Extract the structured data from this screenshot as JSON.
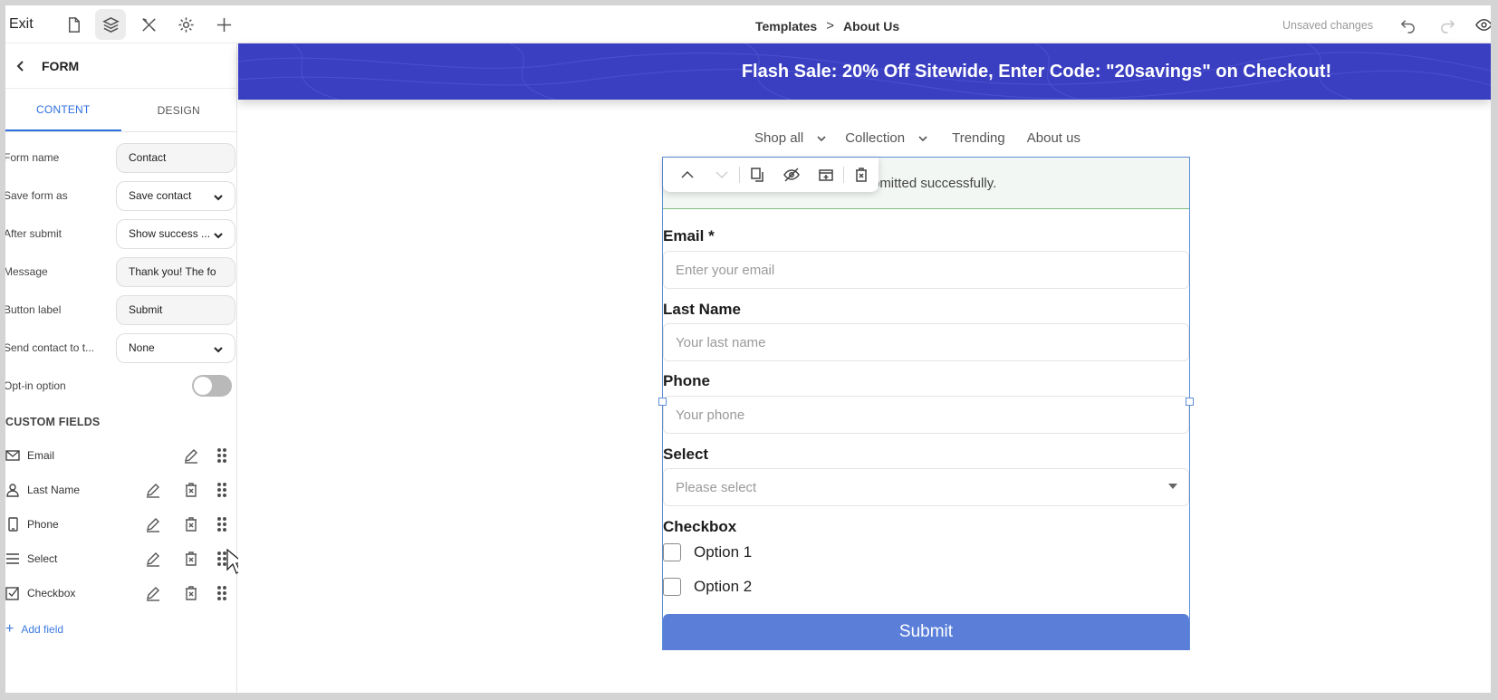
{
  "topbar": {
    "exit_label": "Exit",
    "icons": [
      "page-icon",
      "layers-icon",
      "tools-icon",
      "settings-icon",
      "plus-icon"
    ],
    "breadcrumb": [
      "Templates",
      "About Us"
    ],
    "breadcrumb_separator": ">",
    "status": "Unsaved changes"
  },
  "sidebar": {
    "title": "FORM",
    "tabs": [
      "CONTENT",
      "DESIGN"
    ],
    "active_tab": "CONTENT",
    "properties": [
      {
        "label": "Form name",
        "value": "Contact",
        "type": "text"
      },
      {
        "label": "Save form as",
        "value": "Save contact",
        "type": "select"
      },
      {
        "label": "After submit",
        "value": "Show success ...",
        "type": "select"
      },
      {
        "label": "Message",
        "value": "Thank you! The fo",
        "type": "text"
      },
      {
        "label": "Button label",
        "value": "Submit",
        "type": "text"
      },
      {
        "label": "Send contact to t...",
        "value": "None",
        "type": "select"
      }
    ],
    "optin": {
      "label": "Opt-in option",
      "enabled": false
    },
    "custom_fields_title": "CUSTOM FIELDS",
    "custom_fields": [
      {
        "label": "Email",
        "icon": "mail-icon",
        "deletable": false
      },
      {
        "label": "Last Name",
        "icon": "person-icon",
        "deletable": true
      },
      {
        "label": "Phone",
        "icon": "phone-icon",
        "deletable": true
      },
      {
        "label": "Select",
        "icon": "list-icon",
        "deletable": true
      },
      {
        "label": "Checkbox",
        "icon": "checkbox-icon",
        "deletable": true
      }
    ],
    "add_field_label": "Add field"
  },
  "canvas": {
    "banner_text": "Flash Sale: 20% Off Sitewide, Enter Code: \"20savings\" on Checkout!",
    "banner_color": "#3a3fc2",
    "nav": [
      {
        "label": "Shop all",
        "dropdown": true
      },
      {
        "label": "Collection",
        "dropdown": true
      },
      {
        "label": "Trending",
        "dropdown": false
      },
      {
        "label": "About us",
        "dropdown": false
      }
    ],
    "form": {
      "success_message": "Thank you! The form was submitted successfully.",
      "fields": [
        {
          "label": "Email *",
          "placeholder": "Enter your email",
          "type": "input"
        },
        {
          "label": "Last Name",
          "placeholder": "Your last name",
          "type": "input"
        },
        {
          "label": "Phone",
          "placeholder": "Your phone",
          "type": "input"
        },
        {
          "label": "Select",
          "placeholder": "Please select",
          "type": "select"
        }
      ],
      "checkbox_label": "Checkbox",
      "checkbox_options": [
        "Option 1",
        "Option 2"
      ],
      "submit_label": "Submit",
      "submit_color": "#5b7fd9",
      "toolbar_icons": [
        "move-up-icon",
        "move-down-icon",
        "duplicate-icon",
        "hide-icon",
        "add-section-icon",
        "delete-icon"
      ]
    }
  }
}
